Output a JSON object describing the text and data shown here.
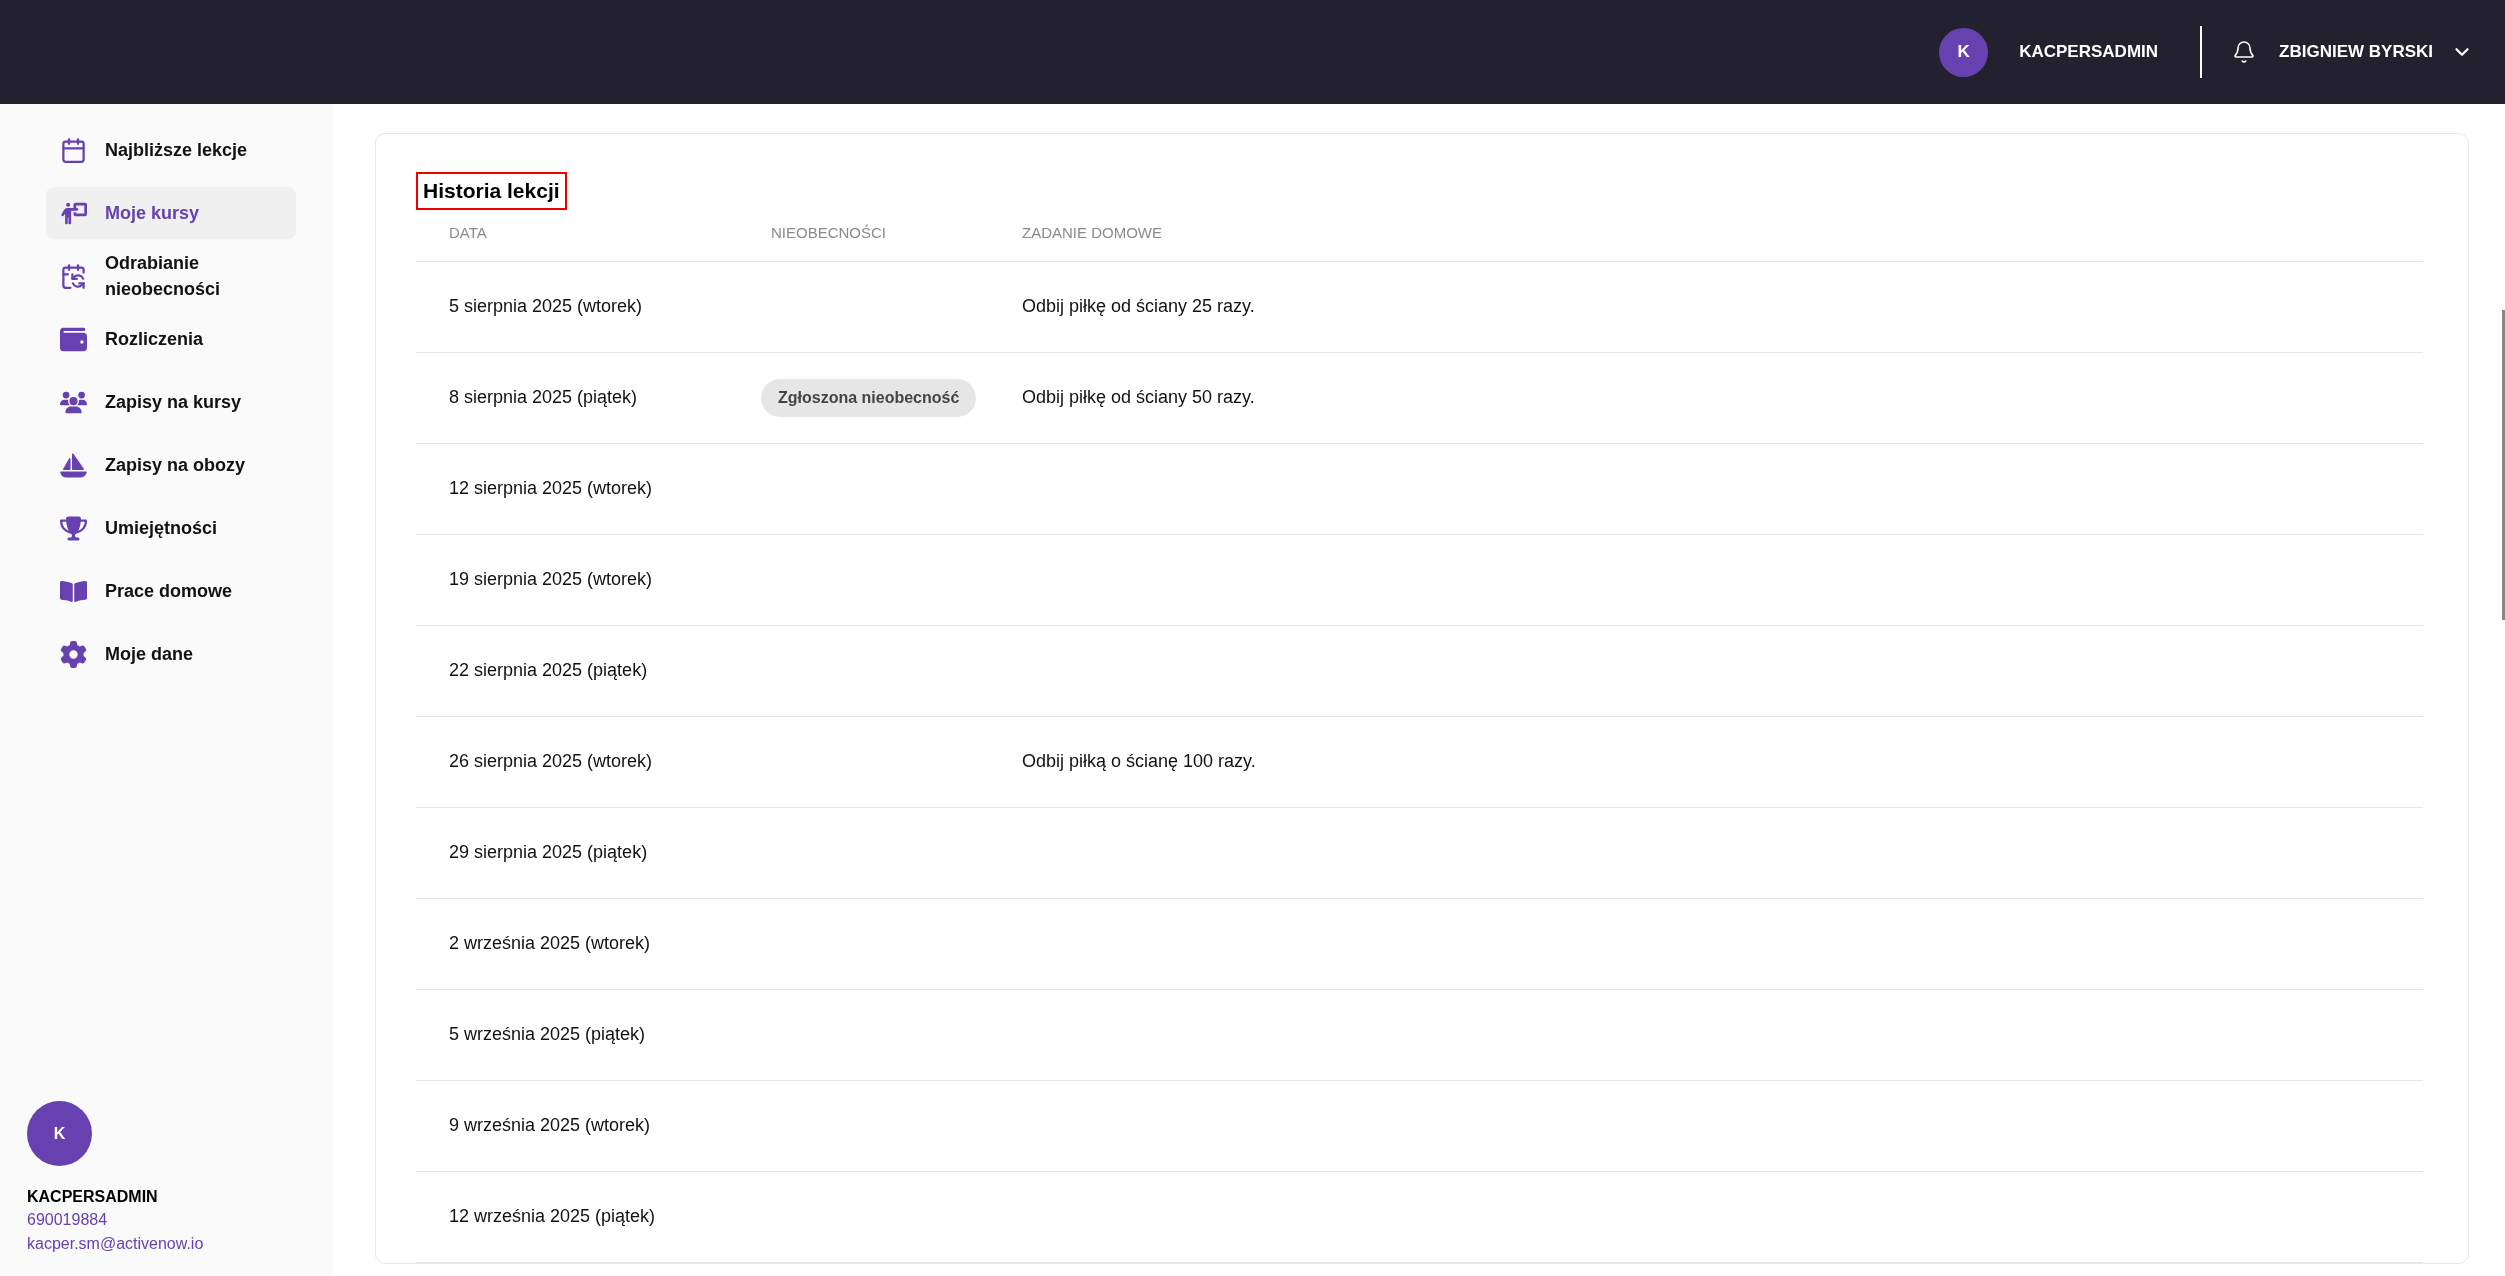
{
  "header": {
    "avatar_letter": "K",
    "username": "KACPERSADMIN",
    "account_name": "ZBIGNIEW BYRSKI"
  },
  "sidebar": {
    "items": [
      {
        "label": "Najbliższe lekcje",
        "selected": false
      },
      {
        "label": "Moje kursy",
        "selected": true
      },
      {
        "label": "Odrabianie nieobecności",
        "selected": false
      },
      {
        "label": "Rozliczenia",
        "selected": false
      },
      {
        "label": "Zapisy na kursy",
        "selected": false
      },
      {
        "label": "Zapisy na obozy",
        "selected": false
      },
      {
        "label": "Umiejętności",
        "selected": false
      },
      {
        "label": "Prace domowe",
        "selected": false
      },
      {
        "label": "Moje dane",
        "selected": false
      }
    ],
    "user": {
      "avatar_letter": "K",
      "name": "KACPERSADMIN",
      "phone": "690019884",
      "email": "kacper.sm@activenow.io"
    }
  },
  "lesson_history": {
    "title": "Historia lekcji",
    "table": {
      "columns": [
        "DATA",
        "NIEOBECNOŚCI",
        "ZADANIE DOMOWE"
      ],
      "rows": [
        {
          "date": "5 sierpnia 2025 (wtorek)",
          "homework": "Odbij piłkę od ściany 25 razy."
        },
        {
          "date": "8 sierpnia 2025 (piątek)",
          "absence": "Zgłoszona nieobecność",
          "homework": "Odbij piłkę od ściany 50 razy."
        },
        {
          "date": "12 sierpnia 2025 (wtorek)"
        },
        {
          "date": "19 sierpnia 2025 (wtorek)"
        },
        {
          "date": "22 sierpnia 2025 (piątek)"
        },
        {
          "date": "26 sierpnia 2025 (wtorek)",
          "homework": "Odbij piłką o ścianę 100 razy."
        },
        {
          "date": "29 sierpnia 2025 (piątek)"
        },
        {
          "date": "2 września 2025 (wtorek)"
        },
        {
          "date": "5 września 2025 (piątek)"
        },
        {
          "date": "9 września 2025 (wtorek)"
        },
        {
          "date": "12 września 2025 (piątek)"
        }
      ]
    }
  }
}
